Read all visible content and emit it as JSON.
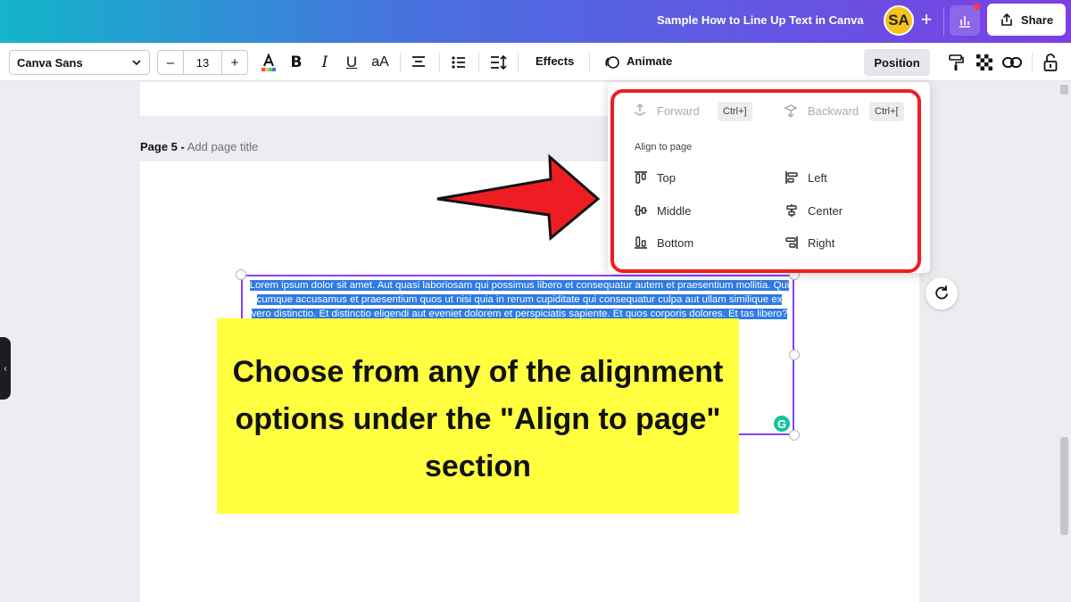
{
  "header": {
    "doc_title": "Sample How to Line Up Text in Canva",
    "avatar_initials": "SA",
    "add_symbol": "+",
    "share_label": "Share"
  },
  "toolbar": {
    "font_family": "Canva Sans",
    "font_size": "13",
    "decrease": "–",
    "increase": "+",
    "case_label": "aA",
    "effects_label": "Effects",
    "animate_label": "Animate",
    "position_label": "Position"
  },
  "canvas": {
    "page_number": "Page 5 -",
    "page_title_placeholder": "Add page title",
    "side_tab": "‹",
    "lorem_text": "Lorem ipsum dolor sit amet. Aut quasi laboriosam qui possimus libero et consequatur autem et praesentium mollitia. Qui cumque accusamus et praesentium quos ut nisi quia in rerum cupiditate qui consequatur culpa aut ullam similique ex vero distinctio. Et distinctio eligendi aut eveniet dolorem et perspiciatis sapiente. Et quos corporis dolores. Et tas libero? Ut ut deleniti modi sed Qui quia"
  },
  "caption": {
    "text": "Choose from any of the alignment options under the \"Align to page\" section"
  },
  "position_menu": {
    "forward": {
      "label": "Forward",
      "shortcut": "Ctrl+]"
    },
    "backward": {
      "label": "Backward",
      "shortcut": "Ctrl+["
    },
    "section_title": "Align to page",
    "align": {
      "top": "Top",
      "middle": "Middle",
      "bottom": "Bottom",
      "left": "Left",
      "center": "Center",
      "right": "Right"
    }
  },
  "colors": {
    "accent": "#8b3dff",
    "highlight_frame": "#ee1d24",
    "caption_bg": "#ffff3f",
    "selection": "#2f7ae5"
  }
}
